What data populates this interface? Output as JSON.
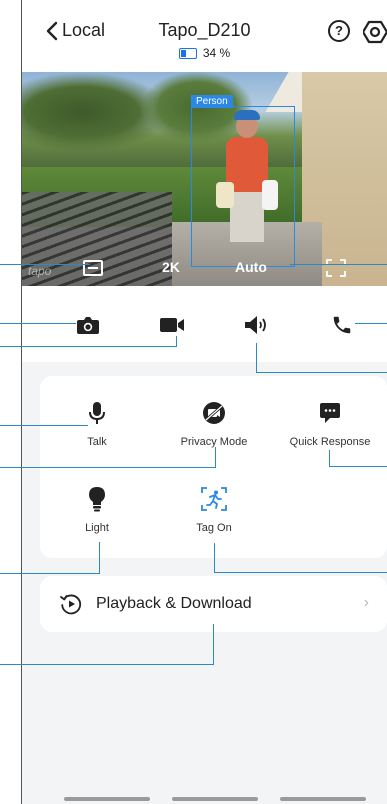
{
  "header": {
    "back_label": "Local",
    "title": "Tapo_D210",
    "battery": "34 %",
    "help_glyph": "?"
  },
  "video": {
    "detection_label": "Person",
    "logo_text": "tapo",
    "resolution": "2K",
    "mode": "Auto"
  },
  "actions": [
    {
      "name": "snapshot",
      "icon": "camera-icon"
    },
    {
      "name": "record",
      "icon": "video-record-icon"
    },
    {
      "name": "speaker",
      "icon": "speaker-icon"
    },
    {
      "name": "call",
      "icon": "phone-icon"
    }
  ],
  "features": {
    "talk": "Talk",
    "privacy": "Privacy Mode",
    "quick_response": "Quick Response",
    "light": "Light",
    "tag": "Tag On"
  },
  "playback": {
    "label": "Playback & Download",
    "chevron": "›"
  },
  "colors": {
    "accent": "#2b88e6",
    "annotation": "#2b8ac0",
    "section_bg": "#f3f4f6"
  }
}
